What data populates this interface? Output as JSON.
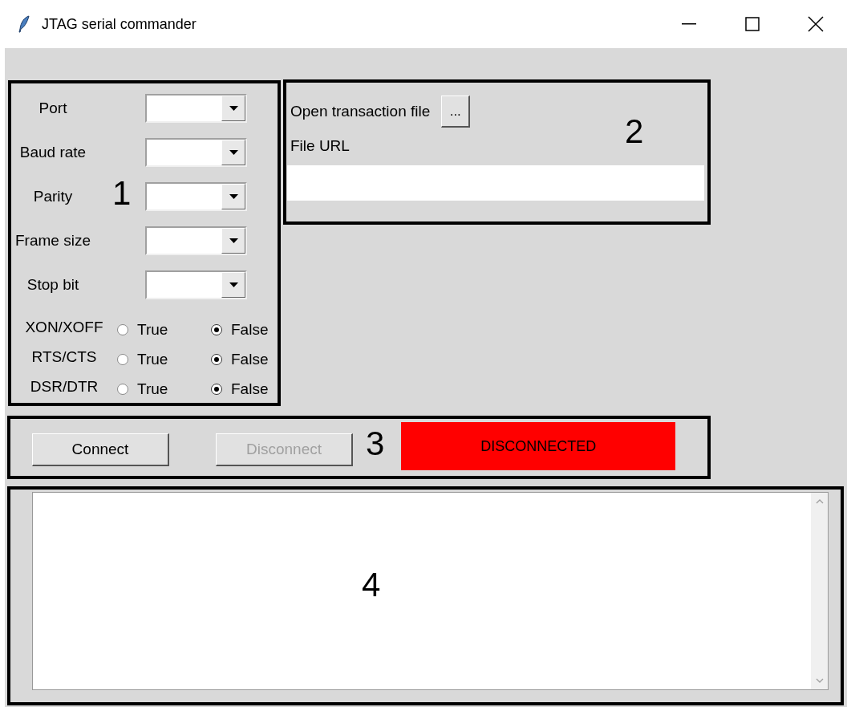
{
  "window": {
    "title": "JTAG serial commander"
  },
  "serial_settings": {
    "fields": [
      {
        "label": "Port"
      },
      {
        "label": "Baud rate"
      },
      {
        "label": "Parity"
      },
      {
        "label": "Frame size"
      },
      {
        "label": "Stop bit"
      }
    ],
    "flow_control": [
      {
        "label": "XON/XOFF",
        "options": [
          {
            "label": "True",
            "selected": false
          },
          {
            "label": "False",
            "selected": true
          }
        ]
      },
      {
        "label": "RTS/CTS",
        "options": [
          {
            "label": "True",
            "selected": false
          },
          {
            "label": "False",
            "selected": true
          }
        ]
      },
      {
        "label": "DSR/DTR",
        "options": [
          {
            "label": "True",
            "selected": false
          },
          {
            "label": "False",
            "selected": true
          }
        ]
      }
    ]
  },
  "file": {
    "open_label": "Open transaction file",
    "browse_button": "...",
    "url_label": "File URL"
  },
  "connection": {
    "buttons": [
      {
        "label": "Connect",
        "disabled": false
      },
      {
        "label": "Disconnect",
        "disabled": true
      }
    ],
    "status": {
      "text": "DISCONNECTED",
      "connected": false
    }
  },
  "annotations": [
    {
      "label": "1"
    },
    {
      "label": "2"
    },
    {
      "label": "3"
    },
    {
      "label": "4"
    }
  ]
}
